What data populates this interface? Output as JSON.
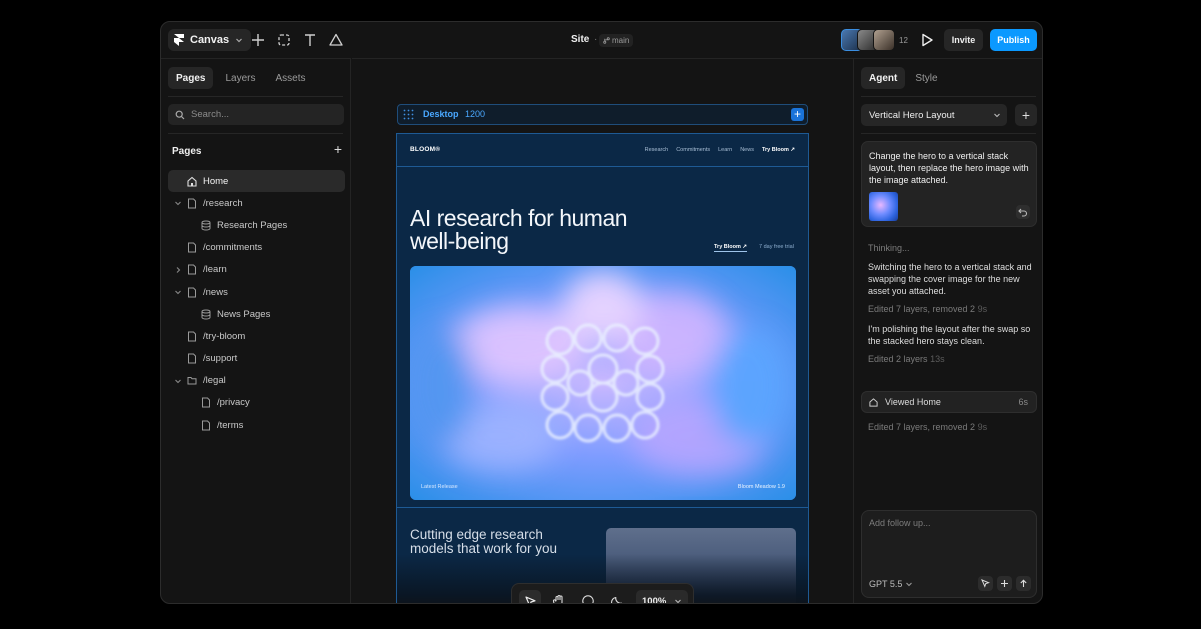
{
  "topbar": {
    "app_menu_label": "Canvas",
    "site_title": "Site",
    "site_separator": "·",
    "branch_label": "main",
    "collaborator_count": "12",
    "invite_label": "Invite",
    "publish_label": "Publish"
  },
  "left_panel": {
    "tabs": [
      "Pages",
      "Layers",
      "Assets"
    ],
    "search_placeholder": "Search...",
    "pages_heading": "Pages",
    "pages": [
      {
        "label": "Home",
        "icon": "home-icon",
        "selected": true
      },
      {
        "label": "/research",
        "icon": "page-icon",
        "expanded": true
      },
      {
        "label": "Research Pages",
        "icon": "collection-icon"
      },
      {
        "label": "/commitments",
        "icon": "page-icon"
      },
      {
        "label": "/learn",
        "icon": "page-icon",
        "expanded": false
      },
      {
        "label": "/news",
        "icon": "page-icon",
        "expanded": true
      },
      {
        "label": "News Pages",
        "icon": "collection-icon"
      },
      {
        "label": "/try-bloom",
        "icon": "page-icon"
      },
      {
        "label": "/support",
        "icon": "page-icon"
      },
      {
        "label": "/legal",
        "icon": "folder-icon",
        "expanded": true
      },
      {
        "label": "/privacy",
        "icon": "page-icon"
      },
      {
        "label": "/terms",
        "icon": "page-icon"
      }
    ]
  },
  "canvas": {
    "frame_name": "Desktop",
    "frame_width": "1200",
    "site": {
      "brand": "BLOOM®",
      "nav_links": [
        "Research",
        "Commitments",
        "Learn",
        "News"
      ],
      "nav_cta": "Try Bloom ↗",
      "hero_title": "AI research for human well-being",
      "hero_cta": "Try Bloom ↗",
      "hero_trial": "7 day free trial",
      "hero_caption_left": "Latest Release",
      "hero_caption_right": "Bloom Meadow 1.9",
      "section_title": "Cutting edge research models that work for you"
    },
    "zoom_label": "100%"
  },
  "right_panel": {
    "tabs": [
      "Agent",
      "Style"
    ],
    "layout_select": "Vertical Hero Layout",
    "prompt": "Change the hero to a vertical stack layout, then replace the hero image with the image attached.",
    "thinking": "Thinking...",
    "message_1": "Switching the hero to a vertical stack and swapping the cover image for the new asset you attached.",
    "meta_1": "Edited 7 layers, removed 2",
    "meta_1_time": "9s",
    "message_2": "I'm polishing the layout after the swap so the stacked hero stays clean.",
    "meta_2": "Edited 2 layers",
    "meta_2_time": "13s",
    "viewed_label": "Viewed Home",
    "viewed_time": "6s",
    "meta_3": "Edited 7 layers, removed 2",
    "meta_3_time": "9s",
    "composer_placeholder": "Add follow up...",
    "model_label": "GPT 5.5"
  },
  "colors": {
    "accent": "#0b99ff",
    "canvas_frame": "#1e5a94",
    "site_background": "#0b2846"
  }
}
